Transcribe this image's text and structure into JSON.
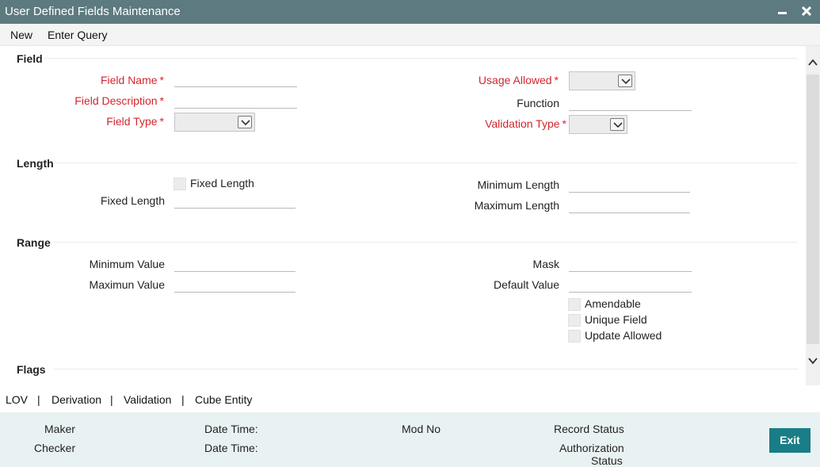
{
  "window": {
    "title": "User Defined Fields Maintenance",
    "minimize_icon": "minimize-icon",
    "close_icon": "close-icon"
  },
  "menu": {
    "new": "New",
    "enter_query": "Enter Query"
  },
  "sections": {
    "field": {
      "title": "Field",
      "field_name": "Field Name",
      "field_description": "Field Description",
      "field_type": "Field Type",
      "usage_allowed": "Usage Allowed",
      "function": "Function",
      "validation_type": "Validation Type",
      "required_marker": "*"
    },
    "length": {
      "title": "Length",
      "fixed_length_checkbox": "Fixed Length",
      "fixed_length": "Fixed Length",
      "minimum_length": "Minimum Length",
      "maximum_length": "Maximum Length"
    },
    "range": {
      "title": "Range",
      "minimum_value": "Minimum Value",
      "maximum_value": "Maximun Value",
      "mask": "Mask",
      "default_value": "Default Value",
      "amendable": "Amendable",
      "unique_field": "Unique Field",
      "update_allowed": "Update Allowed"
    },
    "flags": {
      "title": "Flags"
    }
  },
  "tabs": [
    "LOV",
    "Derivation",
    "Validation",
    "Cube Entity"
  ],
  "tab_separator": "|",
  "footer": {
    "maker": "Maker",
    "checker": "Checker",
    "date_time_1": "Date Time:",
    "date_time_2": "Date Time:",
    "mod_no": "Mod No",
    "record_status": "Record Status",
    "authorization_status_line1": "Authorization",
    "authorization_status_line2": "Status",
    "exit": "Exit"
  },
  "colors": {
    "titlebar": "#5d7a80",
    "required": "#d3262c",
    "footer_bg": "#e9f2f2",
    "exit_button": "#187d86"
  }
}
